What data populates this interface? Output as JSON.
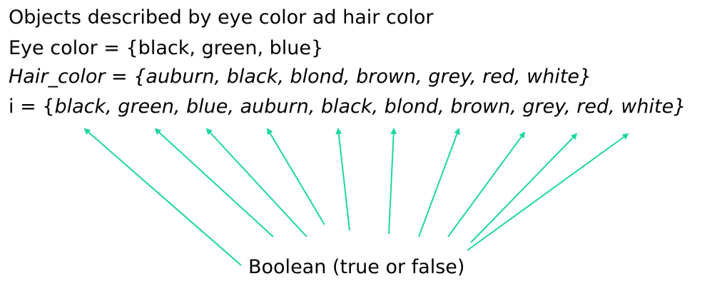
{
  "lines": {
    "line1": "Objects described by eye color ad hair color",
    "line2": "Eye color = {black, green, blue}",
    "line3": "Hair_color = {auburn, black, blond, brown, grey, red, white}",
    "line4_prefix": "i = {",
    "line4_items": "black, green, blue, auburn, black, blond, brown, grey, red, white",
    "line4_suffix": "}"
  },
  "boolean_label": "Boolean (true or false)",
  "colors": {
    "arrow": "#1fd6a0",
    "text": "#000000"
  }
}
